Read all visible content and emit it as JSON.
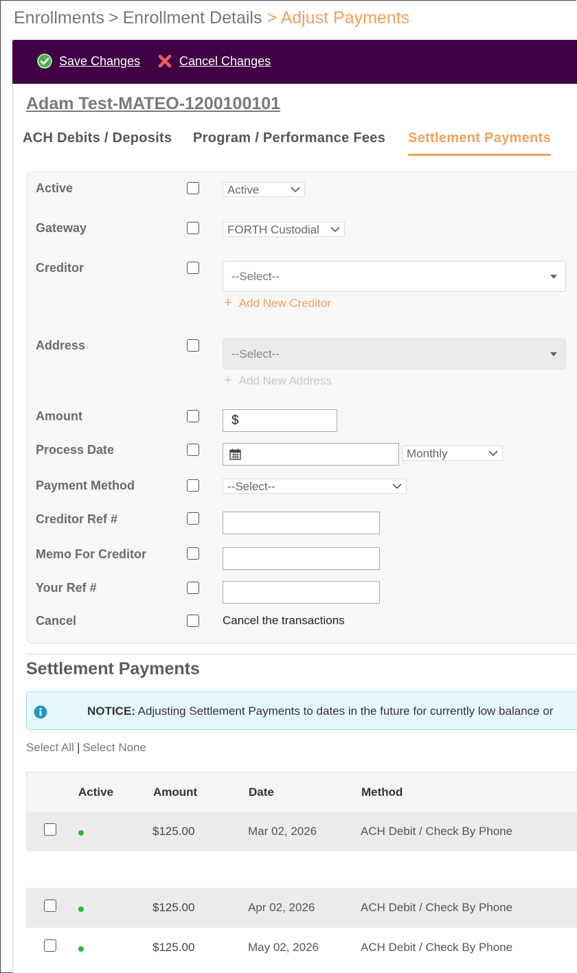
{
  "breadcrumb": {
    "items": [
      "Enrollments",
      "Enrollment Details"
    ],
    "current": "> Adjust Payments",
    "separator": ">"
  },
  "toolbar": {
    "save_label": "Save Changes",
    "cancel_label": "Cancel Changes",
    "background": "#3f0044"
  },
  "client": {
    "name": "Adam Test-MATEO-1200100101"
  },
  "tabs": [
    {
      "label": "ACH Debits / Deposits",
      "active": false
    },
    {
      "label": "Program / Performance Fees",
      "active": false
    },
    {
      "label": "Settlement Payments",
      "active": true
    }
  ],
  "form": {
    "active": {
      "label": "Active",
      "value": "Active"
    },
    "gateway": {
      "label": "Gateway",
      "value": "FORTH Custodial"
    },
    "creditor": {
      "label": "Creditor",
      "placeholder": "--Select--",
      "add_label": "Add New Creditor"
    },
    "address": {
      "label": "Address",
      "placeholder": "--Select--",
      "add_label": "Add New Address"
    },
    "amount": {
      "label": "Amount",
      "currency": "$",
      "value": ""
    },
    "process_date": {
      "label": "Process Date",
      "value": "",
      "frequency": "Monthly"
    },
    "payment_method": {
      "label": "Payment Method",
      "value": "--Select--"
    },
    "creditor_ref": {
      "label": "Creditor Ref #",
      "value": ""
    },
    "memo": {
      "label": "Memo For Creditor",
      "value": ""
    },
    "your_ref": {
      "label": "Your Ref #",
      "value": ""
    },
    "cancel": {
      "label": "Cancel",
      "text": "Cancel the transactions"
    }
  },
  "settlement": {
    "title": "Settlement Payments",
    "notice_bold": "NOTICE:",
    "notice_text": " Adjusting Settlement Payments to dates in the future for currently low balance or",
    "select_all": "Select All",
    "select_none": "Select None",
    "columns": [
      "Active",
      "Amount",
      "Date",
      "Method"
    ],
    "rows": [
      {
        "active": true,
        "amount": "$125.00",
        "date": "Mar 02, 2026",
        "method": "ACH Debit / Check By Phone"
      },
      {
        "active": true,
        "amount": "$125.00",
        "date": "Apr 02, 2026",
        "method": "ACH Debit / Check By Phone"
      },
      {
        "active": true,
        "amount": "$125.00",
        "date": "May 02, 2026",
        "method": "ACH Debit / Check By Phone"
      }
    ]
  },
  "colors": {
    "accent": "#f2a05d",
    "toolbar": "#3f0044",
    "active_dot": "#2eb82e",
    "notice_bg": "#e6f7fb",
    "info_icon": "#2196c4"
  },
  "icons": {
    "save": "check-circle-icon",
    "cancel": "x-mark-icon",
    "add": "plus-icon",
    "calendar": "calendar-icon",
    "info": "info-circle-icon",
    "chevron": "chevron-down-icon"
  }
}
